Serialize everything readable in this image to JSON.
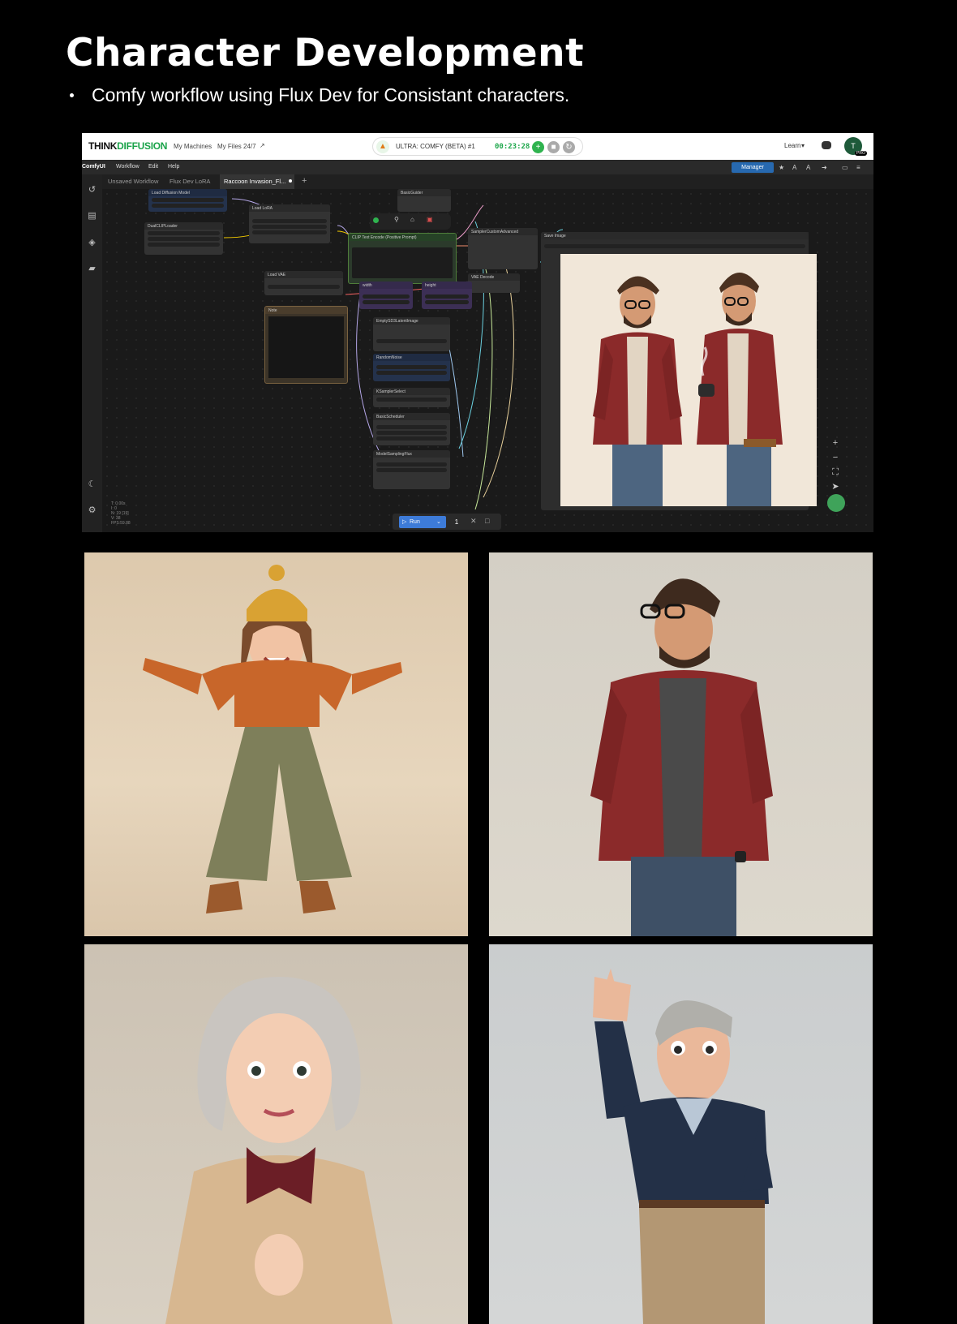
{
  "slide": {
    "title": "Character Development",
    "bullet": "Comfy workflow using Flux Dev for Consistant characters."
  },
  "app": {
    "brand_prefix": "THINK",
    "brand_suffix": "IFFUSION",
    "nav": [
      "My Machines",
      "My Files 24/7"
    ],
    "machine_name": "ULTRA: COMFY (BETA) #1",
    "timer": "00:23:28",
    "learn_label": "Learn",
    "avatar_badge": "PRO"
  },
  "comfy": {
    "menu": [
      "ComfyUI",
      "Workflow",
      "Edit",
      "Help"
    ],
    "manager_label": "Manager",
    "tabs": [
      "Unsaved Workflow",
      "Flux Dev LoRA",
      "Raccoon Invasion_Fl..."
    ],
    "run_label": "Run",
    "run_count": "1",
    "stats": [
      "T: 0.00s",
      "I: 0",
      "N: 19 [19]",
      "V: 38",
      "FPS:59.88"
    ]
  },
  "nodes": {
    "load_diffusion": "Load Diffusion Model",
    "dual_clip": "DualCLIPLoader",
    "load_lora": "Load LoRA",
    "basic_guider": "BasicGuider",
    "clip_text": "CLIP Text Encode (Positive Prompt)",
    "sampler_custom": "SamplerCustomAdvanced",
    "save_image": "Save Image",
    "vae_decode": "VAE Decode",
    "load_vae": "Load VAE",
    "note": "Note",
    "width": "width",
    "height": "height",
    "empty_latent": "EmptySD3LatentImage",
    "random_noise": "RandomNoise",
    "ksampler_select": "KSamplerSelect",
    "basic_scheduler": "BasicScheduler",
    "model_sampling": "ModelSamplingFlux"
  },
  "colors": {
    "brand_green": "#1aa34a",
    "run_blue": "#3d7bd8",
    "manager_blue": "#2769b0"
  },
  "icons": [
    "history-icon",
    "library-icon",
    "cube-icon",
    "folder-icon",
    "moon-icon",
    "settings-icon",
    "discord-icon",
    "star-icon",
    "zoom-in-icon",
    "zoom-out-icon",
    "fit-icon",
    "queue-icon"
  ]
}
